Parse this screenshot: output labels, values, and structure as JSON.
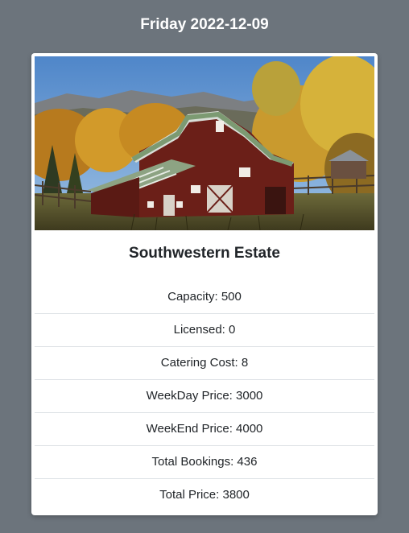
{
  "header": {
    "date_title": "Friday 2022-12-09"
  },
  "venue": {
    "name": "Southwestern Estate",
    "image_subject": "red-barn-with-green-roof-in-autumn-landscape",
    "details": [
      "Capacity: 500",
      "Licensed: 0",
      "Catering Cost: 8",
      "WeekDay Price: 3000",
      "WeekEnd Price: 4000",
      "Total Bookings: 436",
      "Total Price: 3800"
    ]
  },
  "colors": {
    "page_background": "#6c747c",
    "card_background": "#ffffff",
    "text": "#212529",
    "divider": "#dee2e6"
  }
}
